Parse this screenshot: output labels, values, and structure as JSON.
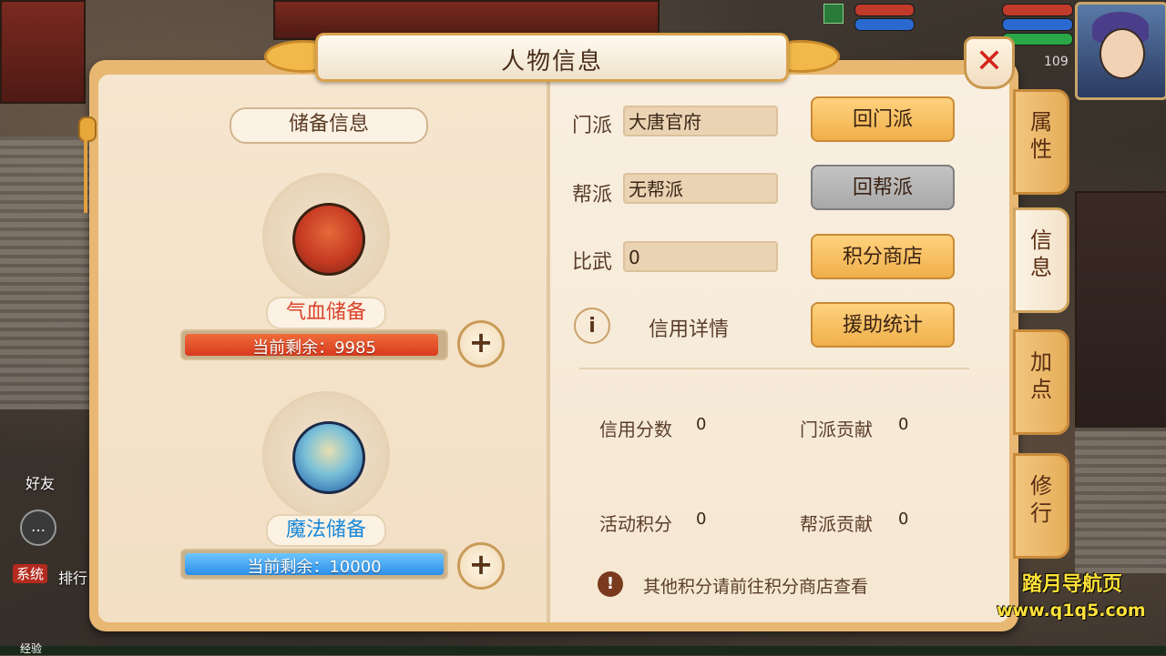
{
  "title": "人物信息",
  "close_icon": "close-x-icon",
  "hud": {
    "level": "109",
    "friends": "好友",
    "system_tag": "系统",
    "rank": "排行",
    "xp": "经验"
  },
  "left": {
    "section_label": "储备信息",
    "hp_store": {
      "label": "气血储备",
      "remaining": "当前剩余：9985",
      "fill_fraction": 0.98
    },
    "mp_store": {
      "label": "魔法储备",
      "remaining": "当前剩余：10000",
      "fill_fraction": 1.0
    }
  },
  "right": {
    "faction_label": "门派",
    "faction_value": "大唐官府",
    "faction_btn": "回门派",
    "guild_label": "帮派",
    "guild_value": "无帮派",
    "guild_btn": "回帮派",
    "pk_label": "比武",
    "pk_value": "0",
    "shop_btn": "积分商店",
    "info_icon": "i",
    "credit_link": "信用详情",
    "assist_btn": "援助统计",
    "stats": {
      "credit_label": "信用分数",
      "credit_value": "0",
      "faction_contrib_label": "门派贡献",
      "faction_contrib_value": "0",
      "activity_label": "活动积分",
      "activity_value": "0",
      "guild_contrib_label": "帮派贡献",
      "guild_contrib_value": "0"
    },
    "warn_icon": "!",
    "note": "其他积分请前往积分商店查看"
  },
  "tabs": [
    {
      "label": "属\n性",
      "active": false
    },
    {
      "label": "信\n息",
      "active": true
    },
    {
      "label": "加\n点",
      "active": false
    },
    {
      "label": "修\n行",
      "active": false
    }
  ],
  "watermark": {
    "line1": "踏月导航页",
    "line2": "www.q1q5.com"
  }
}
